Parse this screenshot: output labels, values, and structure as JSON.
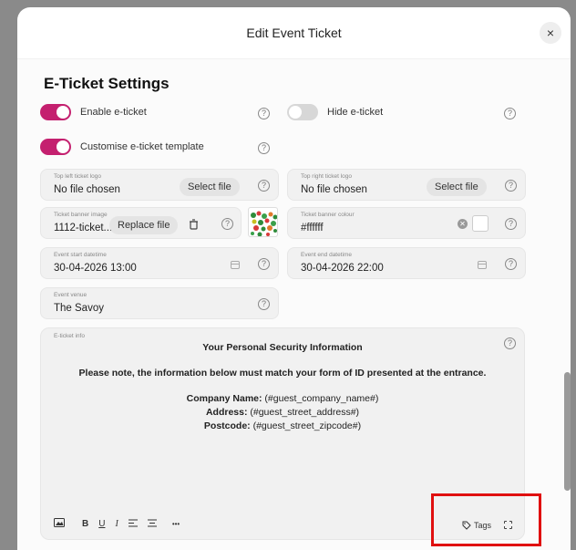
{
  "modal": {
    "title": "Edit Event Ticket",
    "close_icon": "×"
  },
  "section": {
    "title": "E-Ticket Settings"
  },
  "toggles": {
    "enable": {
      "label": "Enable e-ticket",
      "on": true
    },
    "hide": {
      "label": "Hide e-ticket",
      "on": false
    },
    "customise": {
      "label": "Customise e-ticket template",
      "on": true
    }
  },
  "help_glyph": "?",
  "fields": {
    "top_left_logo": {
      "label": "Top left ticket logo",
      "value": "No file chosen",
      "button": "Select file"
    },
    "top_right_logo": {
      "label": "Top right ticket logo",
      "value": "No file chosen",
      "button": "Select file"
    },
    "banner_image": {
      "label": "Ticket banner image",
      "value": "1112-ticket...",
      "button": "Replace file"
    },
    "banner_colour": {
      "label": "Ticket banner colour",
      "value": "#ffffff"
    },
    "start": {
      "label": "Event start datetime",
      "value": "30-04-2026 13:00"
    },
    "end": {
      "label": "Event end datetime",
      "value": "30-04-2026 22:00"
    },
    "venue": {
      "label": "Event venue",
      "value": "The Savoy"
    }
  },
  "editor": {
    "label": "E-ticket info",
    "heading": "Your Personal Security Information",
    "notice": "Please note, the information below must match your form of ID presented at the entrance.",
    "lines": [
      {
        "key": "Company Name:",
        "value": " (#guest_company_name#)"
      },
      {
        "key": "Address:",
        "value": " (#guest_street_address#)"
      },
      {
        "key": "Postcode:",
        "value": " (#guest_street_zipcode#)"
      }
    ],
    "toolbar": {
      "bold": "B",
      "underline": "U",
      "italic": "I",
      "more": "•••"
    },
    "tags_label": "Tags"
  },
  "colors": {
    "accent": "#c4206f",
    "highlight": "#e01010"
  }
}
